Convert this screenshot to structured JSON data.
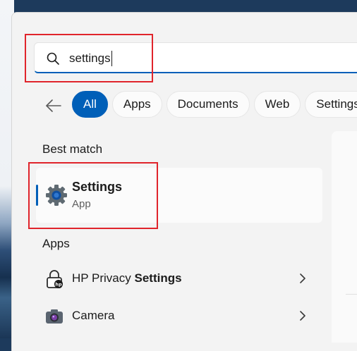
{
  "search": {
    "query": "settings"
  },
  "filters": [
    {
      "label": "All",
      "active": true
    },
    {
      "label": "Apps",
      "active": false
    },
    {
      "label": "Documents",
      "active": false
    },
    {
      "label": "Web",
      "active": false
    },
    {
      "label": "Settings",
      "active": false
    }
  ],
  "best_match": {
    "heading": "Best match",
    "title": "Settings",
    "subtitle": "App",
    "icon": "gear-icon"
  },
  "apps": {
    "heading": "Apps",
    "items": [
      {
        "label_prefix": "HP Privacy ",
        "label_match": "Settings",
        "icon": "lock-icon"
      },
      {
        "label_prefix": "Camera",
        "label_match": "",
        "icon": "camera-icon"
      }
    ]
  },
  "colors": {
    "accent": "#005fb8",
    "annotation": "#e0242b"
  }
}
